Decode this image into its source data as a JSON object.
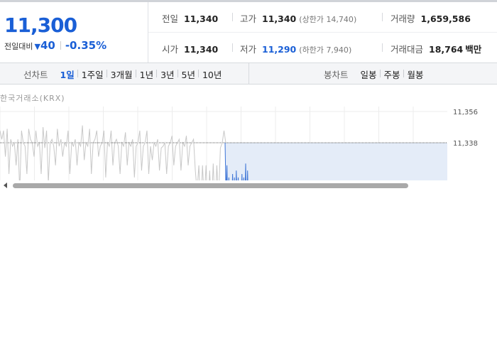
{
  "summary": {
    "price": "11,300",
    "change_label": "전일대비",
    "change_symbol": "▼",
    "change": "40",
    "change_pct": "-0.35%"
  },
  "quote": {
    "prev_close": {
      "label": "전일",
      "value": "11,340"
    },
    "high": {
      "label": "고가",
      "value": "11,340",
      "limit_label": "상한가",
      "limit_value": "14,740"
    },
    "volume": {
      "label": "거래량",
      "value": "1,659,586"
    },
    "open": {
      "label": "시가",
      "value": "11,340"
    },
    "low": {
      "label": "저가",
      "value": "11,290",
      "limit_label": "하한가",
      "limit_value": "7,940"
    },
    "trade_amount": {
      "label": "거래대금",
      "value": "18,764",
      "unit": "백만"
    }
  },
  "line_chart_tabs": {
    "title": "선차트",
    "items": [
      "1일",
      "1주일",
      "3개월",
      "1년",
      "3년",
      "5년",
      "10년"
    ],
    "active": "1일"
  },
  "candle_chart_tabs": {
    "title": "봉차트",
    "items": [
      "일봉",
      "주봉",
      "월봉"
    ]
  },
  "chart": {
    "source": "한국거래소(KRX)",
    "colors": {
      "prev_line": "#c8c8c8",
      "current_line": "#3b73d6",
      "fill": "#e4ecf8",
      "grid": "#ececec"
    }
  },
  "chart_data": {
    "type": "line",
    "title": "",
    "xlabel": "",
    "ylabel": "",
    "y_ticks": [
      "11,356",
      "11,338"
    ],
    "ylim": [
      11290,
      11360
    ],
    "reference_level": 11338,
    "grid": true,
    "series": [
      {
        "values": [
          11345,
          11340,
          11345,
          11330,
          11346,
          11320,
          11340,
          11336,
          11338,
          11325,
          11340,
          11310,
          11345,
          11338,
          11336,
          11320,
          11346,
          11340,
          11338,
          11330,
          11345,
          11336,
          11338,
          11320,
          11347,
          11335,
          11345,
          11315,
          11338,
          11340,
          11336,
          11325,
          11346,
          11336,
          11340,
          11330,
          11338,
          11336,
          11345,
          11320,
          11338,
          11336,
          11340,
          11325,
          11338,
          11336,
          11348,
          11328,
          11338,
          11336,
          11346,
          11320,
          11338,
          11340,
          11345,
          11330,
          11336,
          11338,
          11345,
          11318,
          11338,
          11336,
          11345,
          11325,
          11338,
          11340,
          11336,
          11320,
          11338,
          11336,
          11344,
          11325,
          11338,
          11336,
          11340,
          11318,
          11336,
          11338,
          11345,
          11322,
          11336,
          11338,
          11345,
          11320,
          11336,
          11328,
          11338,
          11336,
          11340,
          11322,
          11335,
          11336,
          11338,
          11320,
          11336,
          11338,
          11342,
          11325,
          11336,
          11338,
          11340,
          11322,
          11338,
          11336,
          11342,
          11325,
          11336,
          11338,
          11340,
          11322,
          11310,
          11325,
          11300,
          11325,
          11305,
          11325,
          11300,
          11322,
          11300,
          11326,
          11300,
          11325,
          11305,
          11335,
          11338,
          11345,
          11338
        ]
      },
      {
        "values": [
          11338,
          11308,
          11325,
          11298,
          11318,
          11300,
          11315,
          11298,
          11320,
          11300,
          11318,
          11298,
          11322,
          11300,
          11318,
          11300,
          11316,
          11298,
          11320,
          11300,
          11318,
          11298,
          11326,
          11298,
          11322,
          11298
        ]
      }
    ]
  }
}
